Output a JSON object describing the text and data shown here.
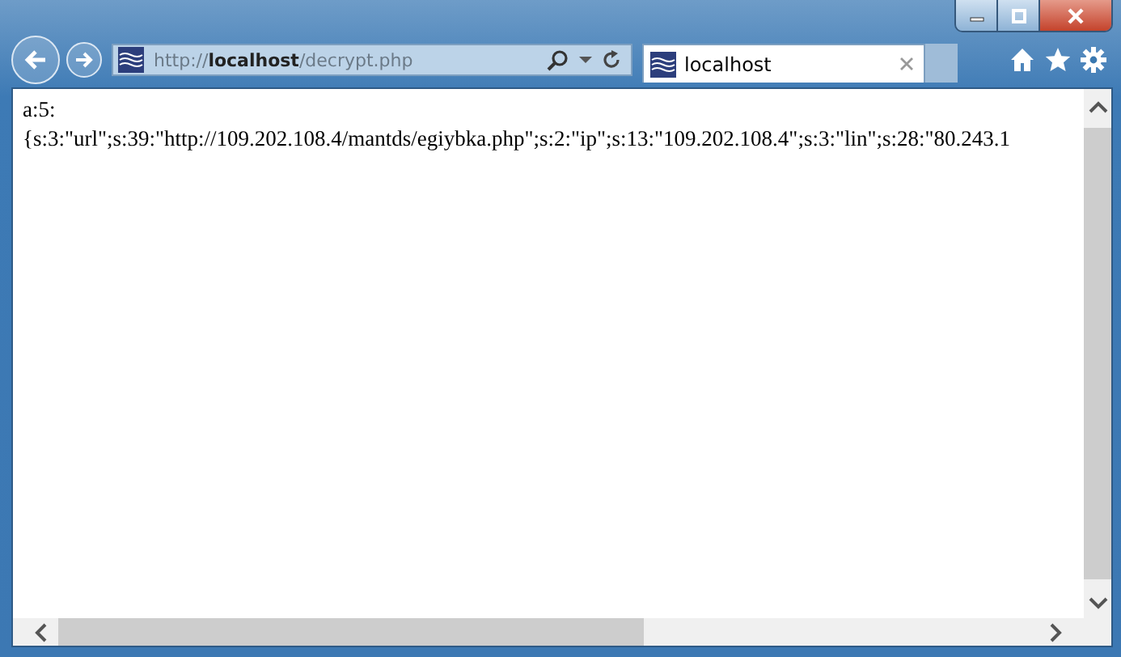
{
  "address_bar": {
    "url": "http://**localhost**/decrypt.php"
  },
  "tabs": [
    {
      "title": "localhost",
      "selected": true
    }
  ],
  "content": {
    "lines": [
      "a:5:",
      "{s:3:\"url\";s:39:\"http://109.202.108.4/mantds/egiybka.php\";s:2:\"ip\";s:13:\"109.202.108.4\";s:3:\"lin\";s:28:\"80.243.1"
    ]
  }
}
